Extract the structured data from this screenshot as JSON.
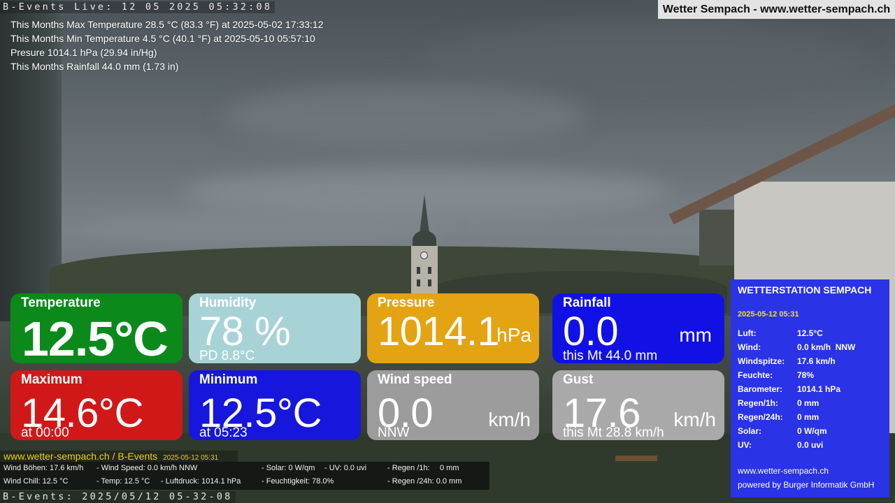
{
  "header": {
    "live_text": "B-Events Live: 12 05 2025 05:32:08",
    "brand": "Wetter Sempach - www.wetter-sempach.ch"
  },
  "stats": {
    "max_temp": "This Months Max Temperature 28.5 °C (83.3 °F) at 2025-05-02 17:33:12",
    "min_temp": "This Months Min Temperature 4.5 °C (40.1 °F) at 2025-05-10 05:57:10",
    "pressure": "Presure 1014.1 hPa (29.94 in/Hg)",
    "rainfall": "This Months Rainfall 44.0 mm (1.73 in)"
  },
  "tiles": {
    "temperature": {
      "title": "Temperature",
      "value": "12.5°C",
      "color": "#0b8a1b"
    },
    "humidity": {
      "title": "Humidity",
      "value": "78 %",
      "sub": "PD 8.8°C",
      "color": "#a8d3d6"
    },
    "pressure": {
      "title": "Pressure",
      "value": "1014.1",
      "unit": "hPa",
      "color": "#e3a312"
    },
    "rainfall": {
      "title": "Rainfall",
      "value": "0.0",
      "unit": "mm",
      "sub": "this Mt 44.0 mm",
      "color": "#1111e6"
    },
    "maximum": {
      "title": "Maximum",
      "value": "14.6°C",
      "sub": "at 00:00",
      "color": "#d11818"
    },
    "minimum": {
      "title": "Minimum",
      "value": "12.5°C",
      "sub": "at 05:23",
      "color": "#1616dc"
    },
    "wind": {
      "title": "Wind speed",
      "value": "0.0",
      "unit": "km/h",
      "sub": "NNW",
      "color": "#9c9c9c"
    },
    "gust": {
      "title": "Gust",
      "value": "17.6",
      "unit": "km/h",
      "sub": "this Mt 28.8 km/h",
      "color": "#a9a9a9"
    }
  },
  "ticker": {
    "site": "www.wetter-sempach.ch / B-Events",
    "date": "2025-05-12 05:31",
    "row1": {
      "a": "Wind Böhen: 17.6 km/h",
      "b": "- Wind Speed: 0.0 km/h NNW",
      "c": "- Solar: 0 W/qm",
      "d": "- UV: 0.0 uvi",
      "e": "- Regen /1h:",
      "f": "0 mm"
    },
    "row2": {
      "a": "Wind Chill: 12.5 °C",
      "b": "- Temp: 12.5 °C",
      "c": "- Luftdruck: 1014.1 hPa",
      "d": "- Feuchtigkeit: 78.0%",
      "e": "- Regen /24h: 0.0 mm"
    }
  },
  "footer": {
    "live_text": "B-Events: 2025/05/12 05-32-08"
  },
  "station": {
    "title": "WETTERSTATION SEMPACH",
    "date": "2025-05-12 05:31",
    "rows": [
      {
        "label": "Luft:",
        "value": "12.5°C"
      },
      {
        "label": "Wind:",
        "value": "0.0 km/h  NNW"
      },
      {
        "label": "Windspitze:",
        "value": "17.6 km/h"
      },
      {
        "label": "Feuchte:",
        "value": "78%"
      },
      {
        "label": "Barometer:",
        "value": "1014.1 hPa"
      },
      {
        "label": "Regen/1h:",
        "value": "0 mm"
      },
      {
        "label": "Regen/24h:",
        "value": "0 mm"
      },
      {
        "label": "Solar:",
        "value": "0 W/qm"
      },
      {
        "label": "UV:",
        "value": "0.0 uvi"
      }
    ],
    "site": "www.wetter-sempach.ch",
    "powered_by": "powered by Burger Informatik GmbH",
    "color": "#2a33e6"
  }
}
